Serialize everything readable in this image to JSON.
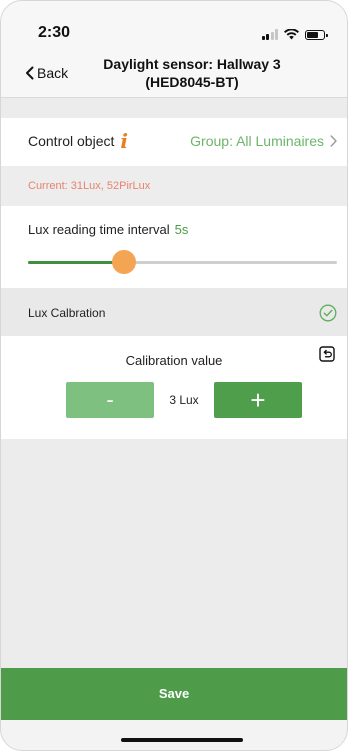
{
  "status_bar": {
    "time": "2:30",
    "icons": [
      "signal-icon",
      "wifi-icon",
      "battery-icon"
    ]
  },
  "nav": {
    "back_label": "Back",
    "title_line1": "Daylight sensor: Hallway 3",
    "title_line2": "(HED8045-BT)"
  },
  "control_object": {
    "label": "Control object",
    "info_icon": "i",
    "value": "Group: All Luminaires"
  },
  "current": {
    "text": "Current: 31Lux,  52PirLux"
  },
  "lux_interval": {
    "label": "Lux reading time interval",
    "value": "5s",
    "slider_fraction": 0.31
  },
  "lux_calibration": {
    "title": "Lux Calbration",
    "status_icon": "check-circle-icon"
  },
  "calibration_panel": {
    "label": "Calibration value",
    "value": "3 Lux",
    "minus_label": "-",
    "plus_label": "+",
    "reset_icon": "reset-icon"
  },
  "save_label": "Save",
  "colors": {
    "accent_green": "#4e9c4a",
    "light_green": "#7dc07f",
    "orange": "#f4a553",
    "current_text": "#e8826f"
  }
}
